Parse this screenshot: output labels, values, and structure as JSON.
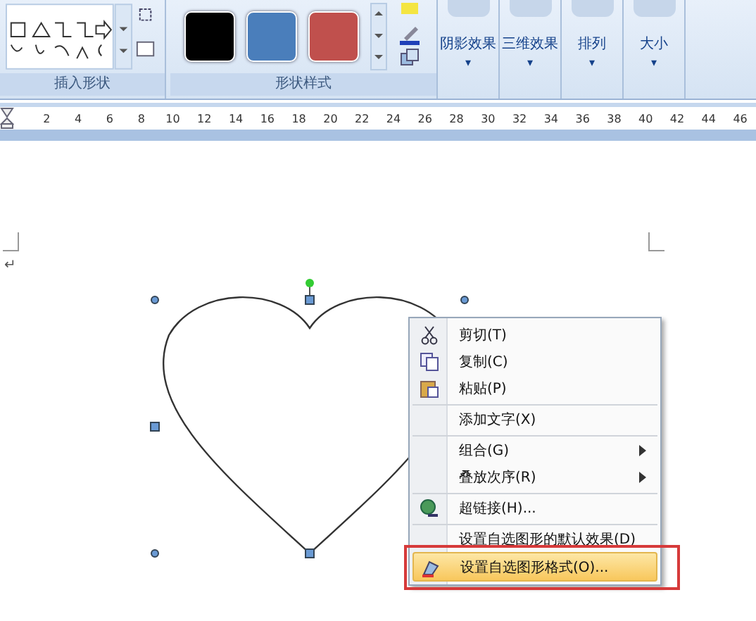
{
  "ribbon": {
    "groups": [
      {
        "kind": "shapes",
        "label": "插入形状"
      },
      {
        "kind": "styles",
        "label": "形状样式",
        "swatches": [
          {
            "color": "#000000"
          },
          {
            "color": "#4a7ebb"
          },
          {
            "color": "#c0504d"
          }
        ]
      }
    ],
    "buttons": [
      {
        "label": "阴影效果",
        "caret": "▾"
      },
      {
        "label": "三维效果",
        "caret": "▾"
      },
      {
        "label": "排列",
        "caret": "▾"
      },
      {
        "label": "大小",
        "caret": "▾"
      }
    ]
  },
  "ruler": {
    "numbers": [
      "2",
      "4",
      "6",
      "8",
      "10",
      "12",
      "14",
      "16",
      "18",
      "20",
      "22",
      "24",
      "26",
      "28",
      "30",
      "32",
      "34",
      "36",
      "38",
      "40",
      "42",
      "44",
      "46"
    ]
  },
  "document": {
    "paragraph_mark": "↵"
  },
  "context_menu": {
    "items": [
      {
        "label": "剪切(T)",
        "kind": "cut",
        "submenu": false,
        "separator_before": false,
        "selected": false
      },
      {
        "label": "复制(C)",
        "kind": "copy",
        "submenu": false,
        "separator_before": false,
        "selected": false
      },
      {
        "label": "粘贴(P)",
        "kind": "paste",
        "submenu": false,
        "separator_before": false,
        "selected": false
      },
      {
        "label": "添加文字(X)",
        "kind": "plain",
        "submenu": false,
        "separator_before": true,
        "selected": false
      },
      {
        "label": "组合(G)",
        "kind": "plain",
        "submenu": true,
        "separator_before": true,
        "selected": false
      },
      {
        "label": "叠放次序(R)",
        "kind": "plain",
        "submenu": true,
        "separator_before": false,
        "selected": false
      },
      {
        "label": "超链接(H)...",
        "kind": "link",
        "submenu": false,
        "separator_before": true,
        "selected": false
      },
      {
        "label": "设置自选图形的默认效果(D)",
        "kind": "plain",
        "submenu": false,
        "separator_before": true,
        "selected": false
      },
      {
        "label": "设置自选图形格式(O)...",
        "kind": "format",
        "submenu": false,
        "separator_before": false,
        "selected": true
      }
    ]
  }
}
